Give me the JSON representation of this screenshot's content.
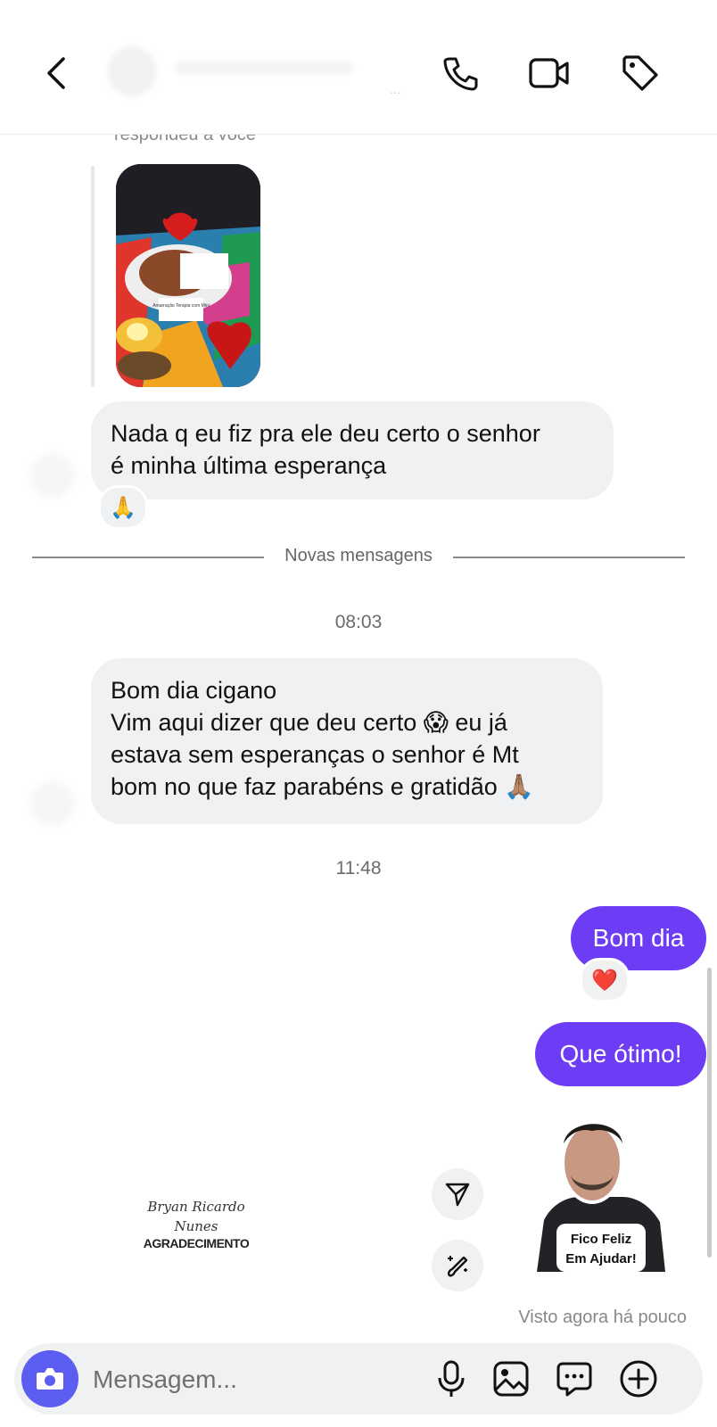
{
  "thread": {
    "reply_label": "respondeu a você"
  },
  "messages": {
    "incoming_1": "Nada q eu fiz pra ele deu certo o senhor\né minha última esperança",
    "incoming_1_reaction": "🙏",
    "new_messages_label": "Novas mensagens",
    "time_1": "08:03",
    "incoming_2": "Bom dia cigano\nVim aqui dizer que deu certo 😱 eu já\nestava sem esperanças o senhor é Mt\nbom no que faz parabéns e gratidão 🙏🏽",
    "time_2": "11:48",
    "outgoing_1": "Bom dia",
    "outgoing_1_reaction": "❤️",
    "outgoing_2": "Que ótimo!"
  },
  "photo_caption": "Amarração Terapia com Mini",
  "logo": {
    "line1": "Bryan Ricardo",
    "line2": "Nunes",
    "line3": "AGRADECIMENTO"
  },
  "sticker": {
    "line1": "Fico Feliz",
    "line2": "Em Ajudar!"
  },
  "seen_status": "Visto agora há pouco",
  "composer": {
    "placeholder": "Mensagem..."
  },
  "icons": {
    "back": "chevron-left-icon",
    "call": "phone-icon",
    "video": "video-camera-icon",
    "tag": "tag-icon",
    "send": "paper-plane-icon",
    "edit": "magic-brush-icon",
    "camera": "camera-icon",
    "mic": "microphone-icon",
    "gallery": "image-icon",
    "sticker": "chat-bubble-icon",
    "more": "plus-circle-icon"
  },
  "colors": {
    "accent": "#6d3cf5",
    "incoming_bubble": "#eff1f3",
    "camera_button": "#5b5ef0"
  }
}
